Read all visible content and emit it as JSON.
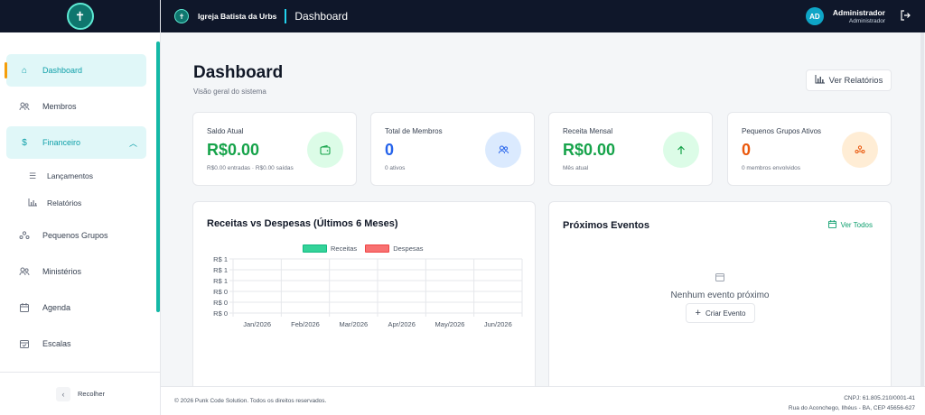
{
  "sidebar": {
    "logo_glyph": "✝",
    "items": [
      {
        "label": "Dashboard",
        "icon": "home-icon"
      },
      {
        "label": "Membros",
        "icon": "users-icon"
      },
      {
        "label": "Financeiro",
        "icon": "dollar-icon"
      },
      {
        "label": "Pequenos Grupos",
        "icon": "groups-icon"
      },
      {
        "label": "Ministérios",
        "icon": "users-icon"
      },
      {
        "label": "Agenda",
        "icon": "calendar-icon"
      },
      {
        "label": "Escalas",
        "icon": "calendar-check-icon"
      }
    ],
    "sub_items": [
      {
        "label": "Lançamentos",
        "icon": "list-icon"
      },
      {
        "label": "Relatórios",
        "icon": "bar-chart-icon"
      }
    ],
    "collapse_label": "Recolher"
  },
  "header": {
    "church_name": "Igreja Batista da Urbs",
    "page": "Dashboard",
    "avatar_initials": "AD",
    "user_name": "Administrador",
    "user_role": "Administrador"
  },
  "main": {
    "title": "Dashboard",
    "subtitle": "Visão geral do sistema",
    "reports_button": "Ver Relatórios",
    "cards": [
      {
        "label": "Saldo Atual",
        "value": "R$0.00",
        "note": "R$0.00 entradas · R$0.00 saídas",
        "color": "#16a34a",
        "icon_bg": "#dcfce7",
        "icon": "wallet-icon"
      },
      {
        "label": "Total de Membros",
        "value": "0",
        "note": "0 ativos",
        "color": "#2563eb",
        "icon_bg": "#dbeafe",
        "icon": "users-icon"
      },
      {
        "label": "Receita Mensal",
        "value": "R$0.00",
        "note": "Mês atual",
        "color": "#16a34a",
        "icon_bg": "#dcfce7",
        "icon": "arrow-up-icon"
      },
      {
        "label": "Pequenos Grupos Ativos",
        "value": "0",
        "note": "0 membros envolvidos",
        "color": "#ea580c",
        "icon_bg": "#ffedd5",
        "icon": "groups-icon"
      }
    ],
    "events": {
      "title": "Próximos Eventos",
      "view_all": "Ver Todos",
      "empty": "Nenhum evento próximo",
      "create": "Criar Evento"
    }
  },
  "chart_data": {
    "type": "bar",
    "title": "Receitas vs Despesas (Últimos 6 Meses)",
    "categories": [
      "Jan/2026",
      "Feb/2026",
      "Mar/2026",
      "Apr/2026",
      "May/2026",
      "Jun/2026"
    ],
    "series": [
      {
        "name": "Receitas",
        "values": [
          0,
          0,
          0,
          0,
          0,
          0
        ],
        "color": "#34d399"
      },
      {
        "name": "Despesas",
        "values": [
          0,
          0,
          0,
          0,
          0,
          0
        ],
        "color": "#f87171"
      }
    ],
    "y_ticks": [
      "R$ 1",
      "R$ 1",
      "R$ 1",
      "R$ 0",
      "R$ 0",
      "R$ 0"
    ],
    "grid": true,
    "legend": "top-center"
  },
  "footer": {
    "copyright": "© 2026 Punk Code Solution. Todos os direitos reservados.",
    "cnpj": "CNPJ: 61.805.210/0001-41",
    "address": "Rua do Aconchego, Ilhéus - BA, CEP 45656-627"
  }
}
